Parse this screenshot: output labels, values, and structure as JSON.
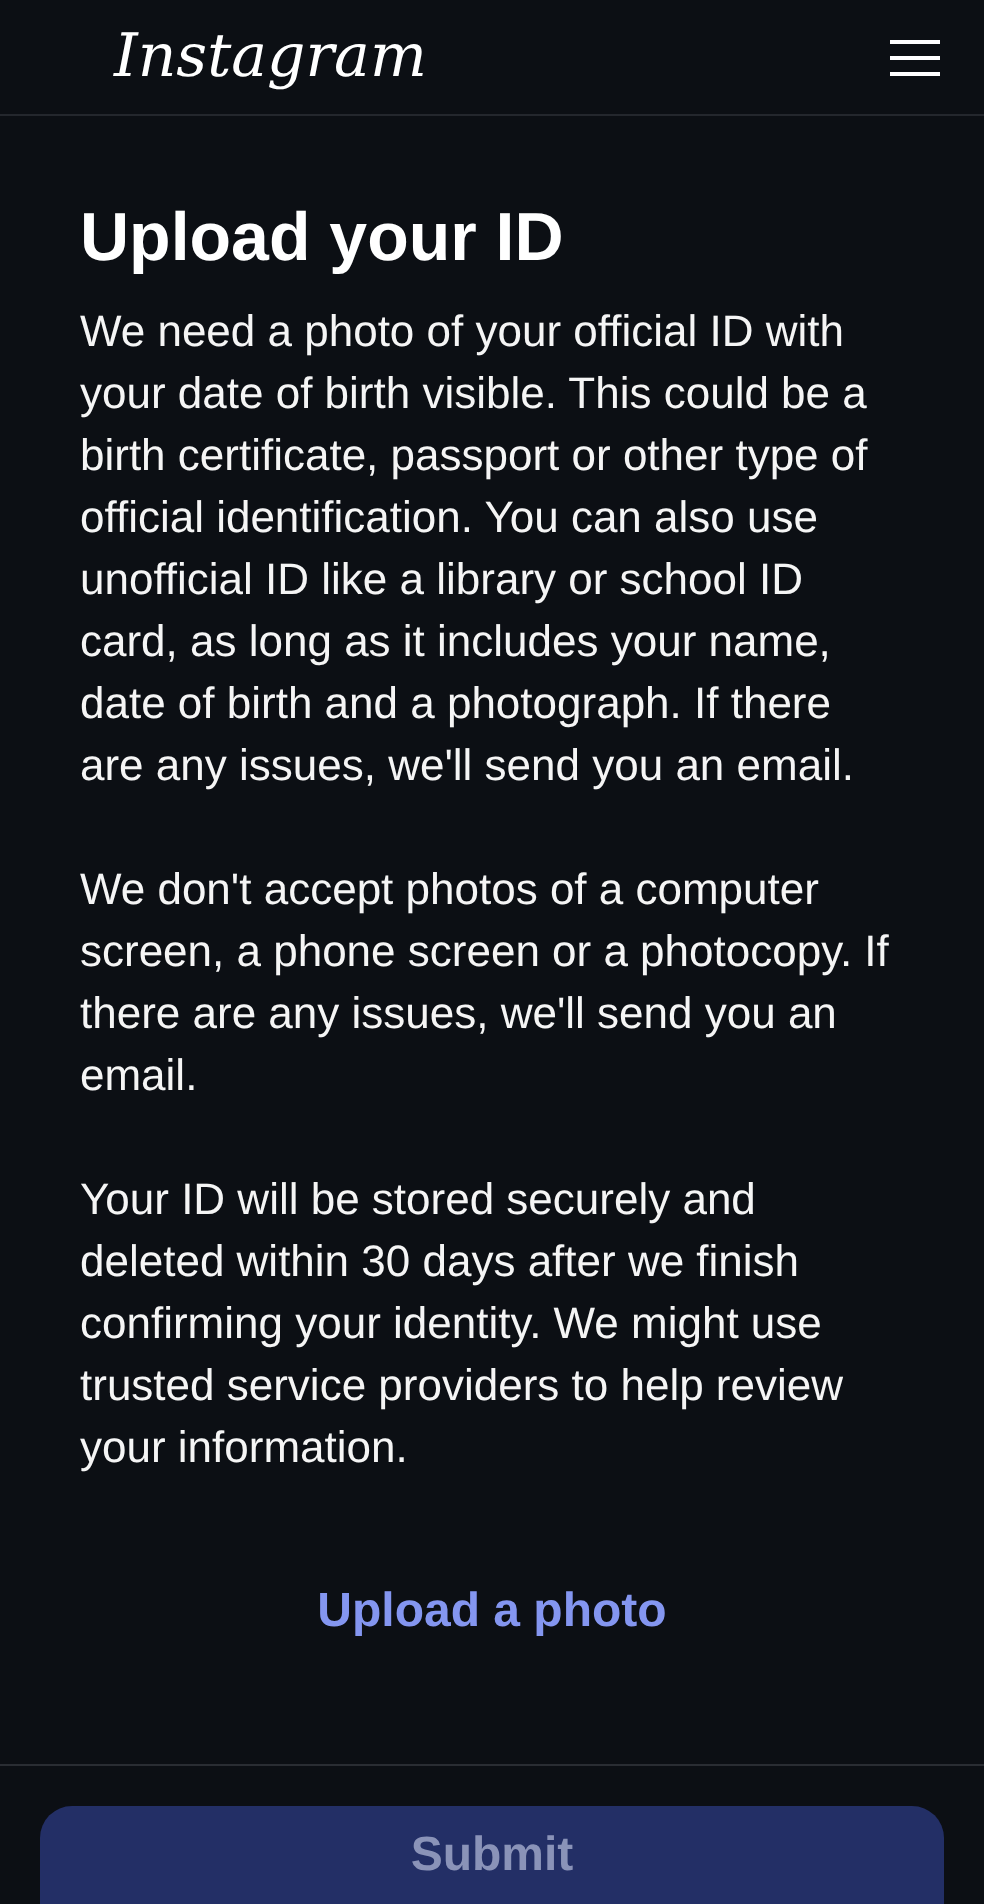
{
  "header": {
    "logo": "Instagram"
  },
  "title": "Upload your ID",
  "paragraphs": [
    "We need a photo of your official ID with your date of birth visible. This could be a birth certificate, passport or other type of official identification. You can also use unofficial ID like a library or school ID card, as long as it includes your name, date of birth and a photograph. If there are any issues, we'll send you an email.",
    "We don't accept photos of a computer screen, a phone screen or a photocopy. If there are any issues, we'll send you an email.",
    "Your ID will be stored securely and deleted within 30 days after we finish confirming your identity. We might use trusted service providers to help review your information."
  ],
  "upload_link": "Upload a photo",
  "submit": {
    "label": "Submit",
    "disabled": true
  }
}
